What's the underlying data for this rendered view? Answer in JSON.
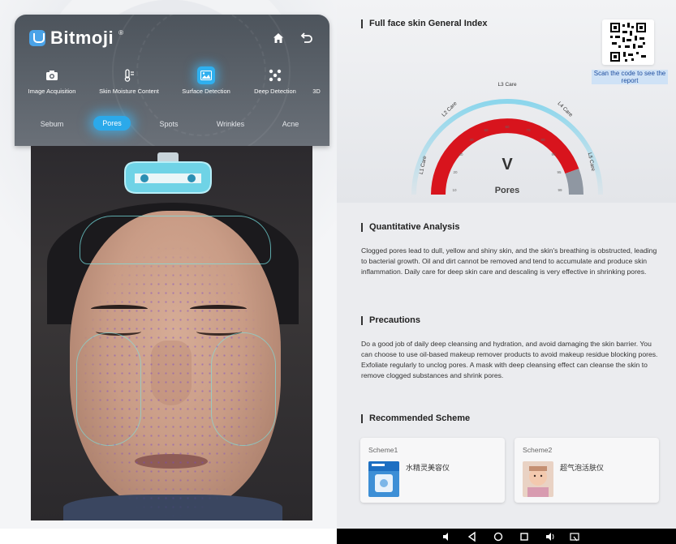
{
  "app": {
    "brand": "Bitmoji",
    "reg": "®"
  },
  "modes": [
    {
      "label": "Image Acquisition",
      "icon": "camera-icon"
    },
    {
      "label": "Skin Moisture Content",
      "icon": "thermometer-icon"
    },
    {
      "label": "Surface Detection",
      "icon": "image-icon",
      "active": true
    },
    {
      "label": "Deep Detection",
      "icon": "dots-icon"
    },
    {
      "label": "3D",
      "icon": "cube-icon"
    }
  ],
  "subtabs": [
    {
      "label": "Sebum"
    },
    {
      "label": "Pores",
      "active": true
    },
    {
      "label": "Spots"
    },
    {
      "label": "Wrinkles"
    },
    {
      "label": "Acne"
    }
  ],
  "report": {
    "index_title": "Full face skin General Index",
    "qr_caption": "Scan the code to see the report",
    "gauge": {
      "value": "V",
      "label": "Pores",
      "zones": [
        "L1 Care",
        "L2 Care",
        "L3 Care",
        "L4 Care",
        "L5 Care"
      ]
    },
    "analysis_title": "Quantitative Analysis",
    "analysis_text": "Clogged pores lead to dull, yellow and shiny skin, and the skin's breathing is obstructed, leading to bacterial growth. Oil and dirt cannot be removed and tend to accumulate and produce skin inflammation. Daily care for deep skin care and descaling is very effective in shrinking pores.",
    "precautions_title": "Precautions",
    "precautions_text": "Do a good job of daily deep cleansing and hydration, and avoid damaging the skin barrier. You can choose to use oil-based makeup remover products to avoid makeup residue blocking pores. Exfoliate regularly to unclog pores. A mask with deep cleansing effect can cleanse the skin to remove clogged substances and shrink pores.",
    "scheme_title": "Recommended Scheme",
    "schemes": [
      {
        "title": "Scheme1",
        "product": "水精灵美容仪"
      },
      {
        "title": "Scheme2",
        "product": "超气泡活肤仪"
      }
    ]
  },
  "colors": {
    "accent": "#2ba9ea",
    "gauge_red": "#d8141d",
    "gauge_gray": "#8f97a2"
  }
}
